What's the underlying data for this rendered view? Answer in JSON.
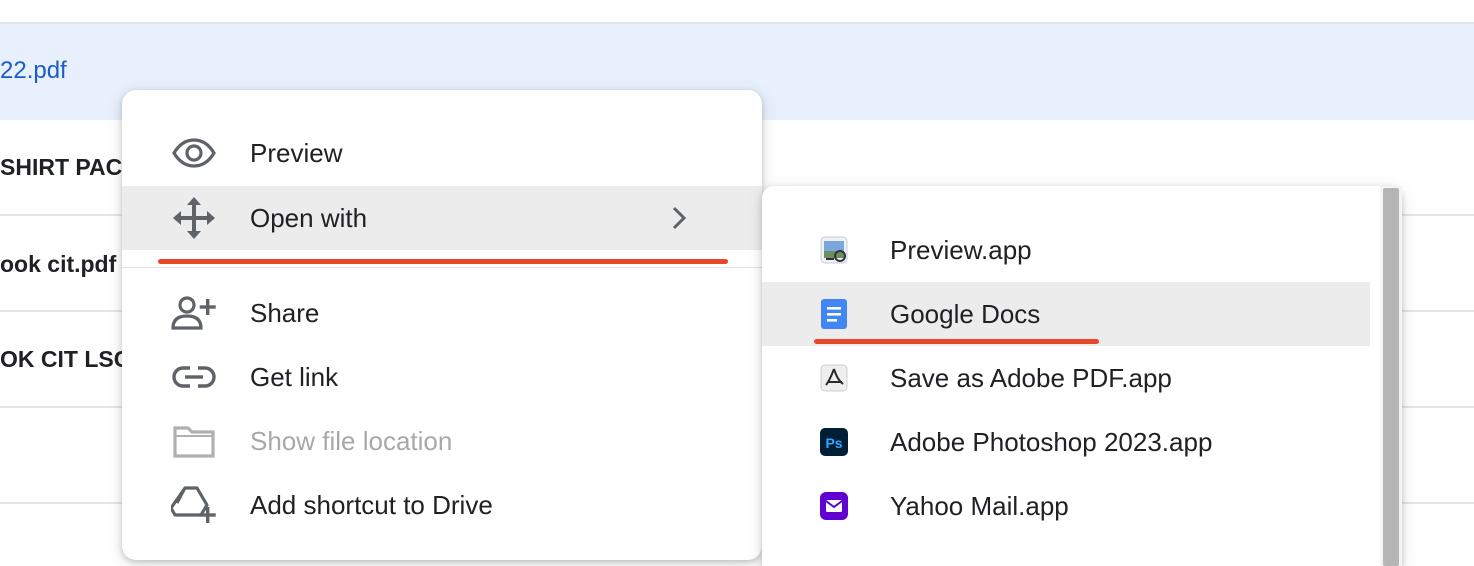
{
  "file_list": {
    "selected_file": "22.pdf",
    "rows": [
      "SHIRT PACK",
      "ook cit.pdf",
      "OK CIT LSC"
    ]
  },
  "context_menu": {
    "items": [
      {
        "label": "Preview",
        "icon": "eye-icon"
      },
      {
        "label": "Open with",
        "icon": "open-with-icon",
        "active": true
      },
      {
        "label": "Share",
        "icon": "person-add-icon"
      },
      {
        "label": "Get link",
        "icon": "link-icon"
      },
      {
        "label": "Show file location",
        "icon": "folder-icon",
        "disabled": true
      },
      {
        "label": "Add shortcut to Drive",
        "icon": "add-shortcut-icon"
      }
    ]
  },
  "open_with_submenu": {
    "items": [
      {
        "label": "Preview.app",
        "icon": "preview-app-icon"
      },
      {
        "label": "Google Docs",
        "icon": "google-docs-icon",
        "active": true
      },
      {
        "label": "Save as Adobe PDF.app",
        "icon": "adobe-pdf-icon"
      },
      {
        "label": "Adobe Photoshop 2023.app",
        "icon": "photoshop-icon"
      },
      {
        "label": "Yahoo Mail.app",
        "icon": "yahoo-mail-icon"
      }
    ]
  },
  "colors": {
    "highlight_underline": "#e8472a",
    "selected_row": "#e8f0fe",
    "link_blue": "#1a5cc8",
    "docs_blue": "#4285f4",
    "photoshop_bg": "#001e36",
    "photoshop_fg": "#31a8ff",
    "yahoo_purple": "#6001d2"
  }
}
